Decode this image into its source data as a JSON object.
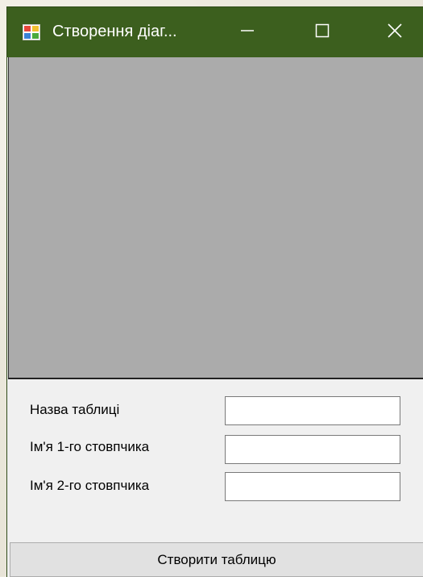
{
  "window": {
    "title": "Створення діаг...",
    "titlebar_color": "#3c5f1e",
    "controls": {
      "minimize_icon": "minimize-icon",
      "maximize_icon": "maximize-icon",
      "close_icon": "close-icon"
    }
  },
  "canvas": {
    "background": "#ababab"
  },
  "form": {
    "fields": [
      {
        "label": "Назва таблиці",
        "value": ""
      },
      {
        "label": "Ім'я 1-го стовпчика",
        "value": ""
      },
      {
        "label": "Ім'я 2-го стовпчика",
        "value": ""
      }
    ],
    "submit_label": "Створити таблицю"
  }
}
